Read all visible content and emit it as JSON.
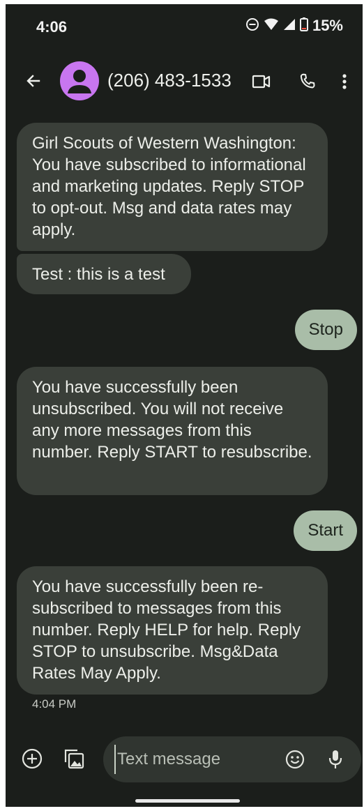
{
  "status_bar": {
    "time": "4:06",
    "battery": "15%",
    "icons": [
      "do-not-disturb-icon",
      "wifi-icon",
      "cell-signal-icon",
      "battery-icon"
    ]
  },
  "header": {
    "contact": "(206) 483-1533",
    "icons": [
      "back-arrow-icon",
      "person-icon",
      "video-call-icon",
      "phone-icon",
      "more-vert-icon"
    ]
  },
  "messages": [
    {
      "direction": "incoming",
      "text": "Girl Scouts of Western Washington: You have subscribed to informational and marketing updates. Reply STOP to opt-out. Msg and data rates may apply."
    },
    {
      "direction": "incoming",
      "text": "Test : this is a test"
    },
    {
      "direction": "outgoing",
      "text": "Stop"
    },
    {
      "direction": "incoming",
      "text": "You have successfully been unsubscribed. You will not receive any more messages from this number. Reply START to resubscribe."
    },
    {
      "direction": "outgoing",
      "text": "Start"
    },
    {
      "direction": "incoming",
      "text": "You have successfully been re-subscribed to messages from this number. Reply HELP for help. Reply STOP to unsubscribe. Msg&Data Rates May Apply."
    }
  ],
  "last_timestamp": "4:04 PM",
  "compose": {
    "placeholder": "Text message",
    "value": "",
    "icons": [
      "add-icon",
      "gallery-icon",
      "emoji-icon",
      "mic-icon"
    ]
  },
  "colors": {
    "background": "#1b1e1b",
    "incoming_bubble": "#3a3f39",
    "outgoing_bubble": "#a9bda8",
    "avatar": "#c876f0"
  }
}
